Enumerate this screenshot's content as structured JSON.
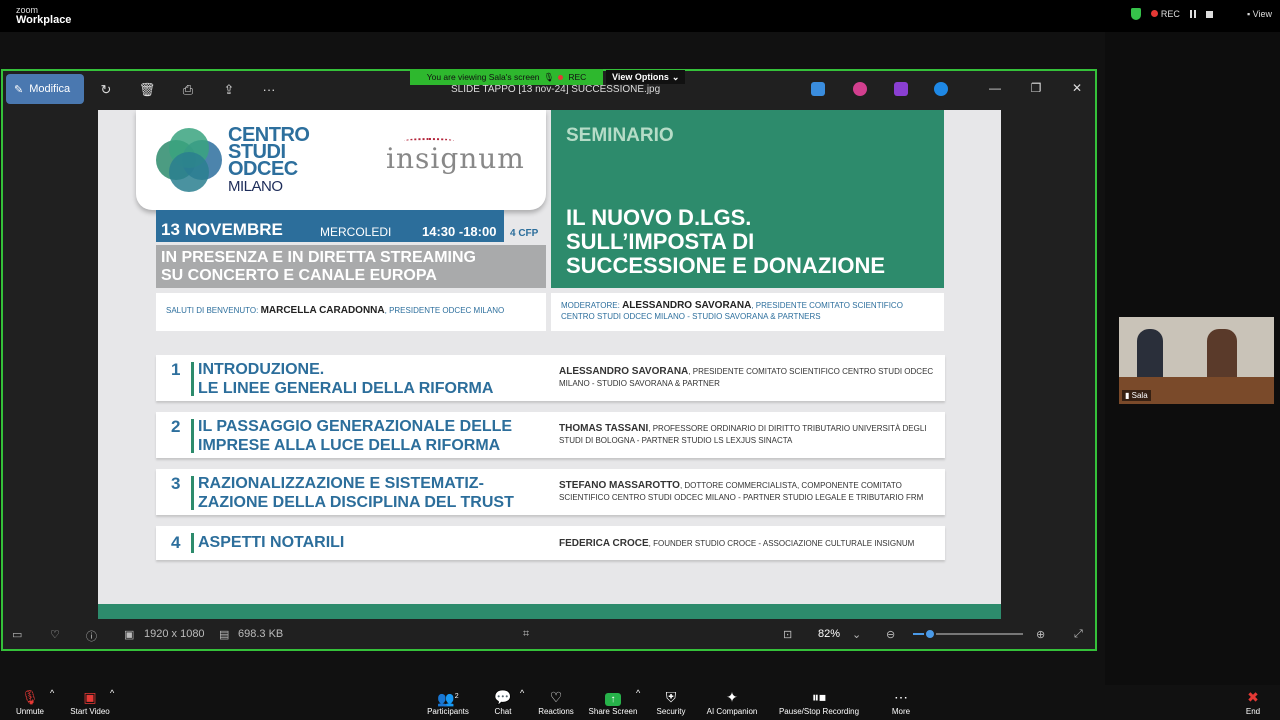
{
  "zoom": {
    "logo_line1": "zoom",
    "logo_line2": "Workplace",
    "rec": "REC",
    "view": "View",
    "banner_text": "You are viewing  Sala's screen",
    "banner_rec": "REC",
    "view_options": "View Options"
  },
  "viewer": {
    "edit_label": "Modifica",
    "file_title": "SLIDE TAPPO [13 nov-24] SUCCESSIONE.jpg",
    "dimensions": "1920 x 1080",
    "file_size": "698.3 KB",
    "zoom_level": "82%",
    "zoom_fraction": 0.15
  },
  "slide": {
    "centro_studi": [
      "CENTRO",
      "STUDI",
      "ODCEC"
    ],
    "milano": "MILANO",
    "insignum": "insignum",
    "seminar_label": "SEMINARIO",
    "seminar_title": [
      "IL NUOVO D.LGS.",
      "SULL’IMPOSTA DI",
      "SUCCESSIONE E DONAZIONE"
    ],
    "date": "13 NOVEMBRE",
    "day": "MERCOLEDI",
    "time": "14:30 -18:00",
    "cfp": "4 CFP",
    "streaming": [
      "IN PRESENZA E IN DIRETTA STREAMING",
      "SU CONCERTO E CANALE EUROPA"
    ],
    "welcome_label": "SALUTI DI BENVENUTO:",
    "welcome_name": "MARCELLA CARADONNA",
    "welcome_role": ", PRESIDENTE ODCEC MILANO",
    "moderator_label": "MODERATORE:",
    "moderator_name": "ALESSANDRO SAVORANA",
    "moderator_role": ", PRESIDENTE COMITATO SCIENTIFICO CENTRO STUDI ODCEC MILANO - STUDIO SAVORANA & PARTNERS",
    "rows": [
      {
        "num": "1",
        "topic": [
          "INTRODUZIONE.",
          "LE LINEE GENERALI DELLA RIFORMA"
        ],
        "speaker": "ALESSANDRO SAVORANA",
        "role": ", PRESIDENTE COMITATO SCIENTIFICO CENTRO STUDI ODCEC MILANO - STUDIO SAVORANA & PARTNER"
      },
      {
        "num": "2",
        "topic": [
          "IL PASSAGGIO GENERAZIONALE DELLE",
          "IMPRESE ALLA LUCE DELLA RIFORMA"
        ],
        "speaker": "THOMAS TASSANI",
        "role": ", PROFESSORE ORDINARIO DI DIRITTO TRIBUTARIO UNIVERSITÀ DEGLI STUDI DI BOLOGNA - PARTNER STUDIO LS LEXJUS SINACTA"
      },
      {
        "num": "3",
        "topic": [
          "RAZIONALIZZAZIONE E SISTEMATIZ-",
          "ZAZIONE DELLA DISCIPLINA DEL TRUST"
        ],
        "speaker": "STEFANO MASSAROTTO",
        "role": ", DOTTORE COMMERCIALISTA, COMPONENTE COMITATO SCIENTIFICO CENTRO STUDI ODCEC MILANO - PARTNER STUDIO LEGALE E TRIBUTARIO FRM"
      },
      {
        "num": "4",
        "topic": [
          "ASPETTI NOTARILI",
          ""
        ],
        "speaker": "FEDERICA CROCE",
        "role": ", FOUNDER STUDIO CROCE - ASSOCIAZIONE CULTURALE INSIGNUM"
      }
    ]
  },
  "participant": {
    "name": "Sala"
  },
  "toolbar": {
    "unmute": "Unmute",
    "start_video": "Start Video",
    "participants": "Participants",
    "participants_count": "2",
    "chat": "Chat",
    "reactions": "Reactions",
    "share_screen": "Share Screen",
    "security": "Security",
    "ai_companion": "AI Companion",
    "pause_stop": "Pause/Stop Recording",
    "more": "More",
    "end": "End"
  }
}
